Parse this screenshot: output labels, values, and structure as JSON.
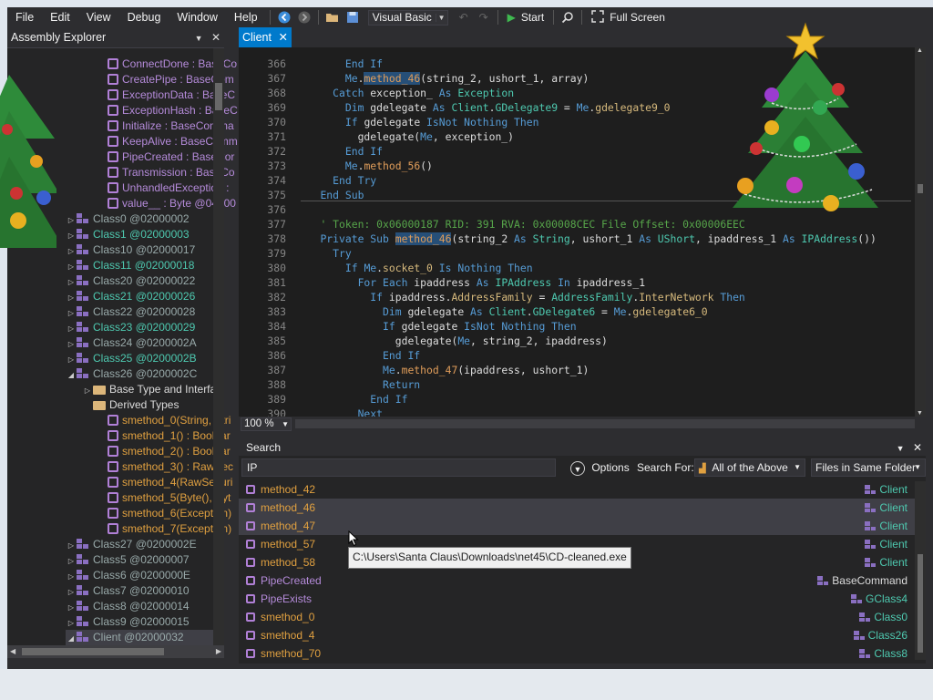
{
  "menu": [
    "File",
    "Edit",
    "View",
    "Debug",
    "Window",
    "Help"
  ],
  "toolbar": {
    "language": "Visual Basic",
    "start_label": "Start",
    "fullscreen_label": "Full Screen"
  },
  "assembly_explorer": {
    "title": "Assembly Explorer",
    "items": [
      {
        "label": "ConnectDone : BaseCo",
        "kind": "member"
      },
      {
        "label": "CreatePipe : BaseCom",
        "kind": "member"
      },
      {
        "label": "ExceptionData : BaseC",
        "kind": "member"
      },
      {
        "label": "ExceptionHash : BaseC",
        "kind": "member"
      },
      {
        "label": "Initialize : BaseComma",
        "kind": "member"
      },
      {
        "label": "KeepAlive : BaseComm",
        "kind": "member"
      },
      {
        "label": "PipeCreated : BaseCor",
        "kind": "member"
      },
      {
        "label": "Transmission : BaseCo",
        "kind": "member"
      },
      {
        "label": "UnhandledException :",
        "kind": "member"
      },
      {
        "label": "value__ : Byte @04000",
        "kind": "member"
      },
      {
        "label": "Class0 @02000002",
        "kind": "class"
      },
      {
        "label": "Class1 @02000003",
        "kind": "class"
      },
      {
        "label": "Class10 @02000017",
        "kind": "class"
      },
      {
        "label": "Class11 @02000018",
        "kind": "class"
      },
      {
        "label": "Class20 @02000022",
        "kind": "class"
      },
      {
        "label": "Class21 @02000026",
        "kind": "class"
      },
      {
        "label": "Class22 @02000028",
        "kind": "class"
      },
      {
        "label": "Class23 @02000029",
        "kind": "class"
      },
      {
        "label": "Class24 @0200002A",
        "kind": "class"
      },
      {
        "label": "Class25 @0200002B",
        "kind": "class"
      },
      {
        "label": "Class26 @0200002C",
        "kind": "class-open"
      },
      {
        "label": "Base Type and Interfac",
        "kind": "folder"
      },
      {
        "label": "Derived Types",
        "kind": "folder2"
      },
      {
        "label": "smethod_0(String, Stri",
        "kind": "method"
      },
      {
        "label": "smethod_1() : Boolear",
        "kind": "method"
      },
      {
        "label": "smethod_2() : Boolear",
        "kind": "method"
      },
      {
        "label": "smethod_3() : RawSec",
        "kind": "method"
      },
      {
        "label": "smethod_4(RawSecuri",
        "kind": "method"
      },
      {
        "label": "smethod_5(Byte(), Byt",
        "kind": "method"
      },
      {
        "label": "smethod_6(Exception)",
        "kind": "method"
      },
      {
        "label": "smethod_7(Exception)",
        "kind": "method"
      },
      {
        "label": "Class27 @0200002E",
        "kind": "class"
      },
      {
        "label": "Class5 @02000007",
        "kind": "class"
      },
      {
        "label": "Class6 @0200000E",
        "kind": "class"
      },
      {
        "label": "Class7 @02000010",
        "kind": "class"
      },
      {
        "label": "Class8 @02000014",
        "kind": "class"
      },
      {
        "label": "Class9 @02000015",
        "kind": "class"
      },
      {
        "label": "Client @02000032",
        "kind": "class-open-sel"
      }
    ]
  },
  "editor": {
    "tab": "Client",
    "zoom": "100 %",
    "lines": [
      {
        "n": "366",
        "indent": 8,
        "parts": [
          [
            "kw",
            "End If"
          ]
        ]
      },
      {
        "n": "367",
        "indent": 8,
        "parts": [
          [
            "kw",
            "Me"
          ],
          [
            "t",
            "."
          ],
          [
            "fnh",
            "method_46"
          ],
          [
            "t",
            "(string_2, ushort_1, array)"
          ]
        ]
      },
      {
        "n": "368",
        "indent": 6,
        "parts": [
          [
            "kw",
            "Catch"
          ],
          [
            "t",
            " exception_ "
          ],
          [
            "kw",
            "As"
          ],
          [
            "t",
            " "
          ],
          [
            "ty",
            "Exception"
          ]
        ]
      },
      {
        "n": "369",
        "indent": 8,
        "parts": [
          [
            "kw",
            "Dim"
          ],
          [
            "t",
            " gdelegate "
          ],
          [
            "kw",
            "As"
          ],
          [
            "t",
            " "
          ],
          [
            "ty",
            "Client"
          ],
          [
            "t",
            "."
          ],
          [
            "ty",
            "GDelegate9"
          ],
          [
            "t",
            " = "
          ],
          [
            "kw",
            "Me"
          ],
          [
            "t",
            "."
          ],
          [
            "pr",
            "gdelegate9_0"
          ]
        ]
      },
      {
        "n": "370",
        "indent": 8,
        "parts": [
          [
            "kw",
            "If"
          ],
          [
            "t",
            " gdelegate "
          ],
          [
            "kw",
            "IsNot Nothing Then"
          ]
        ]
      },
      {
        "n": "371",
        "indent": 10,
        "parts": [
          [
            "t",
            "gdelegate("
          ],
          [
            "kw",
            "Me"
          ],
          [
            "t",
            ", exception_)"
          ]
        ]
      },
      {
        "n": "372",
        "indent": 8,
        "parts": [
          [
            "kw",
            "End If"
          ]
        ]
      },
      {
        "n": "373",
        "indent": 8,
        "parts": [
          [
            "kw",
            "Me"
          ],
          [
            "t",
            "."
          ],
          [
            "fn",
            "method_56"
          ],
          [
            "t",
            "()"
          ]
        ]
      },
      {
        "n": "374",
        "indent": 6,
        "parts": [
          [
            "kw",
            "End Try"
          ]
        ]
      },
      {
        "n": "375",
        "indent": 4,
        "parts": [
          [
            "kw",
            "End Sub"
          ]
        ]
      },
      {
        "n": "376",
        "indent": 0,
        "parts": []
      },
      {
        "n": "377",
        "indent": 4,
        "parts": [
          [
            "cm",
            "' Token: 0x06000187 RID: 391 RVA: 0x00008CEC File Offset: 0x00006EEC"
          ]
        ]
      },
      {
        "n": "378",
        "indent": 4,
        "parts": [
          [
            "kw",
            "Private Sub"
          ],
          [
            "t",
            " "
          ],
          [
            "fnh",
            "method_46"
          ],
          [
            "t",
            "(string_2 "
          ],
          [
            "kw",
            "As"
          ],
          [
            "t",
            " "
          ],
          [
            "ty",
            "String"
          ],
          [
            "t",
            ", ushort_1 "
          ],
          [
            "kw",
            "As"
          ],
          [
            "t",
            " "
          ],
          [
            "ty",
            "UShort"
          ],
          [
            "t",
            ", ipaddress_1 "
          ],
          [
            "kw",
            "As"
          ],
          [
            "t",
            " "
          ],
          [
            "ty",
            "IPAddress"
          ],
          [
            "t",
            "())"
          ]
        ]
      },
      {
        "n": "379",
        "indent": 6,
        "parts": [
          [
            "kw",
            "Try"
          ]
        ]
      },
      {
        "n": "380",
        "indent": 8,
        "parts": [
          [
            "kw",
            "If"
          ],
          [
            "t",
            " "
          ],
          [
            "kw",
            "Me"
          ],
          [
            "t",
            "."
          ],
          [
            "pr",
            "socket_0"
          ],
          [
            "t",
            " "
          ],
          [
            "kw",
            "Is Nothing Then"
          ]
        ]
      },
      {
        "n": "381",
        "indent": 10,
        "parts": [
          [
            "kw",
            "For Each"
          ],
          [
            "t",
            " ipaddress "
          ],
          [
            "kw",
            "As"
          ],
          [
            "t",
            " "
          ],
          [
            "ty",
            "IPAddress"
          ],
          [
            "t",
            " "
          ],
          [
            "kw",
            "In"
          ],
          [
            "t",
            " ipaddress_1"
          ]
        ]
      },
      {
        "n": "382",
        "indent": 12,
        "parts": [
          [
            "kw",
            "If"
          ],
          [
            "t",
            " ipaddress."
          ],
          [
            "pr",
            "AddressFamily"
          ],
          [
            "t",
            " = "
          ],
          [
            "ty",
            "AddressFamily"
          ],
          [
            "t",
            "."
          ],
          [
            "pr",
            "InterNetwork"
          ],
          [
            "t",
            " "
          ],
          [
            "kw",
            "Then"
          ]
        ]
      },
      {
        "n": "383",
        "indent": 14,
        "parts": [
          [
            "kw",
            "Dim"
          ],
          [
            "t",
            " gdelegate "
          ],
          [
            "kw",
            "As"
          ],
          [
            "t",
            " "
          ],
          [
            "ty",
            "Client"
          ],
          [
            "t",
            "."
          ],
          [
            "ty",
            "GDelegate6"
          ],
          [
            "t",
            " = "
          ],
          [
            "kw",
            "Me"
          ],
          [
            "t",
            "."
          ],
          [
            "pr",
            "gdelegate6_0"
          ]
        ]
      },
      {
        "n": "384",
        "indent": 14,
        "parts": [
          [
            "kw",
            "If"
          ],
          [
            "t",
            " gdelegate "
          ],
          [
            "kw",
            "IsNot Nothing Then"
          ]
        ]
      },
      {
        "n": "385",
        "indent": 16,
        "parts": [
          [
            "t",
            "gdelegate("
          ],
          [
            "kw",
            "Me"
          ],
          [
            "t",
            ", string_2, ipaddress)"
          ]
        ]
      },
      {
        "n": "386",
        "indent": 14,
        "parts": [
          [
            "kw",
            "End If"
          ]
        ]
      },
      {
        "n": "387",
        "indent": 14,
        "parts": [
          [
            "kw",
            "Me"
          ],
          [
            "t",
            "."
          ],
          [
            "fn",
            "method_47"
          ],
          [
            "t",
            "(ipaddress, ushort_1)"
          ]
        ]
      },
      {
        "n": "388",
        "indent": 14,
        "parts": [
          [
            "kw",
            "Return"
          ]
        ]
      },
      {
        "n": "389",
        "indent": 12,
        "parts": [
          [
            "kw",
            "End If"
          ]
        ]
      },
      {
        "n": "390",
        "indent": 10,
        "parts": [
          [
            "kw",
            "Next"
          ]
        ]
      }
    ]
  },
  "search": {
    "title": "Search",
    "query": "IP",
    "options_label": "Options",
    "search_for_label": "Search For:",
    "search_for_value": "All of the Above",
    "scope_value": "Files in Same Folder",
    "results": [
      {
        "name": "method_42",
        "loc": "Client",
        "color": "#e0a040"
      },
      {
        "name": "method_46",
        "loc": "Client",
        "color": "#e0a040"
      },
      {
        "name": "method_47",
        "loc": "Client",
        "color": "#e0a040"
      },
      {
        "name": "method_57",
        "loc": "Client",
        "color": "#e0a040"
      },
      {
        "name": "method_58",
        "loc": "Client",
        "color": "#e0a040"
      },
      {
        "name": "PipeCreated",
        "loc": "BaseCommand",
        "color": "#b58bda"
      },
      {
        "name": "PipeExists",
        "loc": "GClass4",
        "color": "#b58bda"
      },
      {
        "name": "smethod_0",
        "loc": "Class0",
        "color": "#e0a040"
      },
      {
        "name": "smethod_4",
        "loc": "Class26",
        "color": "#e0a040"
      },
      {
        "name": "smethod_70",
        "loc": "Class8",
        "color": "#e0a040"
      }
    ],
    "tooltip": "C:\\Users\\Santa Claus\\Downloads\\net45\\CD-cleaned.exe"
  },
  "colors": {
    "accent": "#007acc",
    "background": "#1e1e1e",
    "panel": "#252526"
  }
}
